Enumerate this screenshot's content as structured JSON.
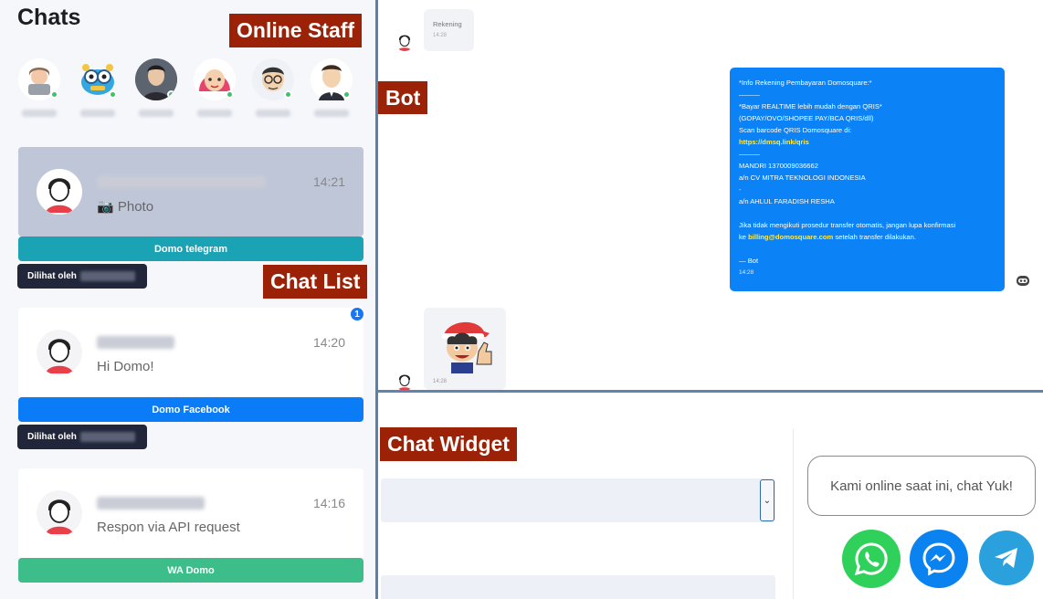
{
  "chats_title": "Chats",
  "labels": {
    "online_staff": "Online Staff",
    "bot": "Bot",
    "chat_list": "Chat List",
    "chat_widget": "Chat Widget"
  },
  "chat_list": [
    {
      "time": "14:21",
      "message": "📷 Photo",
      "channel": "Domo telegram",
      "channel_color": "#1aa3b5",
      "seen_label": "Dilihat oleh"
    },
    {
      "time": "14:20",
      "message": "Hi Domo!",
      "channel": "Domo Facebook",
      "channel_color": "#0a7cf7",
      "seen_label": "Dilihat oleh",
      "unread": "1"
    },
    {
      "time": "14:16",
      "message": "Respon via API request",
      "channel": "WA Domo",
      "channel_color": "#3dbd8a"
    }
  ],
  "conversation": {
    "first_bubble_text": "Rekening",
    "first_bubble_time": "14:28",
    "bot_message": {
      "lines": [
        "*Info Rekening Pembayaran Domosquare:*",
        "———",
        "*Bayar REALTIME lebih mudah dengan QRIS*",
        "(GOPAY/OVO/SHOPEE PAY/BCA QRIS/dll)",
        "Scan barcode QRIS Domosquare di:",
        "https://dmsq.link/qris",
        "———",
        "MANDRI 1370009036662",
        "a/n CV MITRA TEKNOLOGI INDONESIA",
        "-",
        "a/n AHLUL FARADISH RESHA",
        "",
        "Jika tidak mengikuti prosedur transfer otomatis, jangan lupa konfirmasi",
        "ke",
        "billing@domosquare.com",
        "setelah transfer dilakukan.",
        "",
        "— Bot"
      ],
      "time": "14:28"
    },
    "sticker_time": "14:28"
  },
  "widget": {
    "prompt": "Kami online saat ini, chat Yuk!"
  }
}
